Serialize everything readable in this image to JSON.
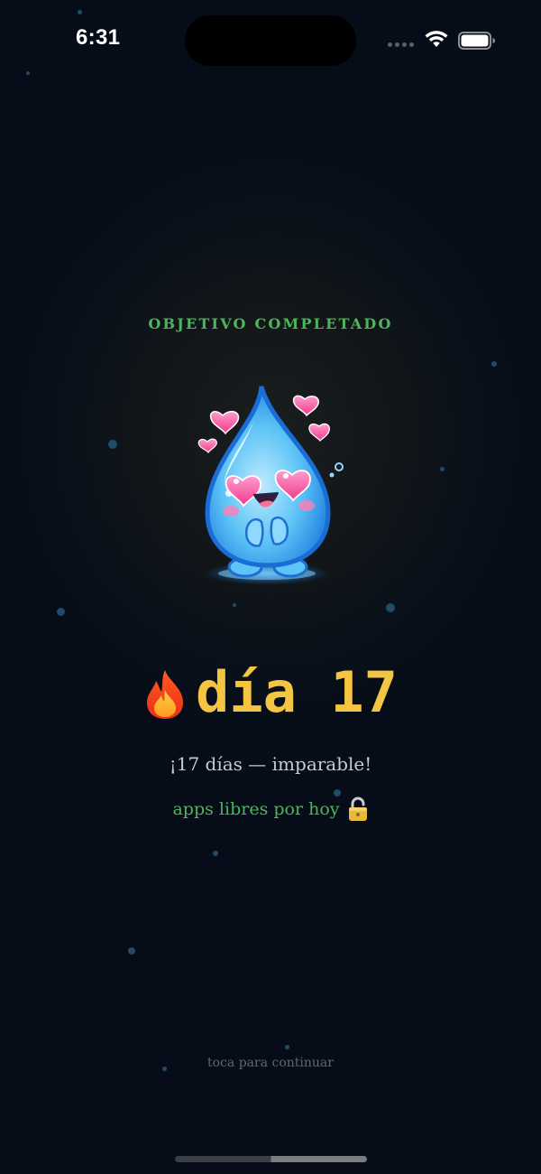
{
  "status_bar": {
    "time": "6:31"
  },
  "goal": {
    "label": "OBJETIVO COMPLETADO"
  },
  "mascot": {
    "icon": "happy-water-drop-mascot",
    "accent_color": "#4db55a"
  },
  "streak": {
    "icon": "fire-icon",
    "text": "día 17",
    "color": "#f4c443"
  },
  "message": "¡17 días — imparable!",
  "unlocked": {
    "text": "apps libres por hoy",
    "icon": "unlocked-padlock-icon"
  },
  "footer": {
    "continue_hint": "toca para continuar"
  }
}
